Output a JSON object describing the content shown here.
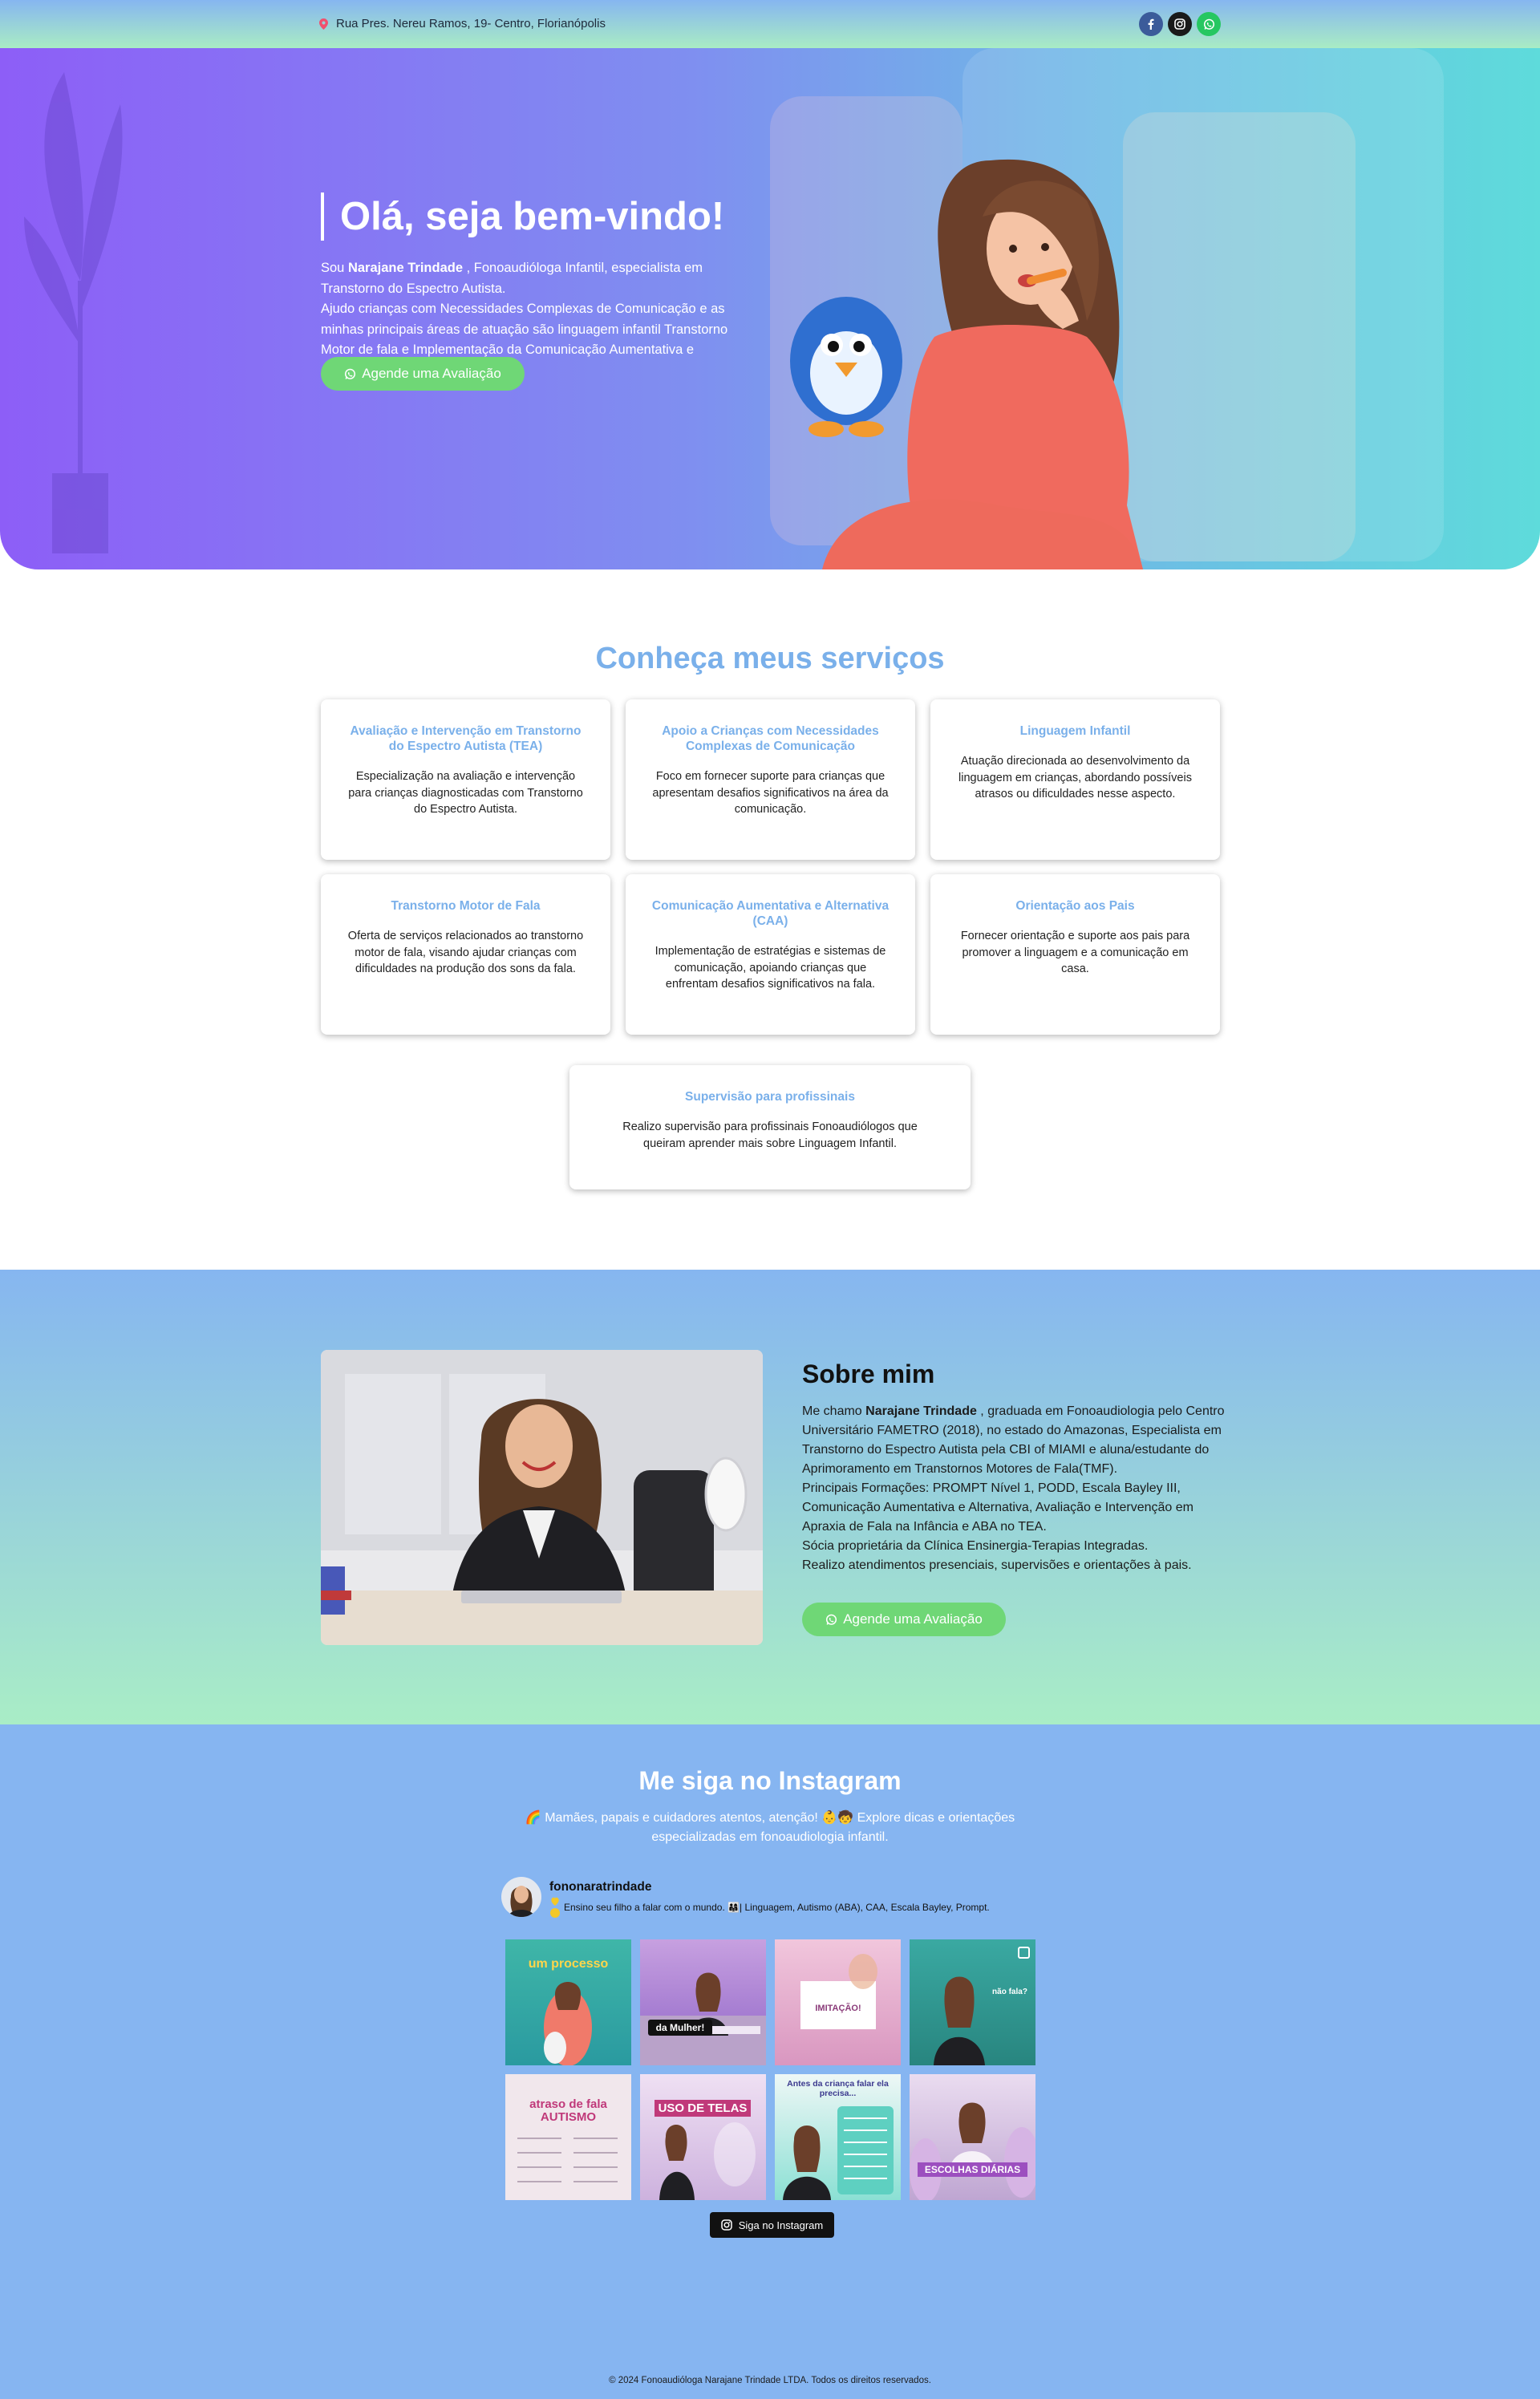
{
  "topbar": {
    "address": "Rua Pres. Nereu Ramos, 19- Centro, Florianópolis",
    "social": [
      "facebook-icon",
      "instagram-icon",
      "whatsapp-icon"
    ]
  },
  "hero": {
    "title": "Olá, seja bem-vindo!",
    "intro_prefix": "Sou ",
    "name": "Narajane Trindade",
    "intro_suffix": " , Fonoaudióloga Infantil, especialista em Transtorno do Espectro Autista.",
    "line2": "Ajudo crianças com Necessidades Complexas de Comunicação e as minhas principais áreas de atuação são linguagem infantil Transtorno Motor de fala e Implementação da Comunicação Aumentativa e Alternativa(CAA).",
    "cta": "Agende uma Avaliação"
  },
  "services": {
    "title": "Conheça meus serviços",
    "items": [
      {
        "title": "Avaliação e Intervenção em Transtorno do Espectro Autista (TEA)",
        "text": "Especialização na avaliação e intervenção para crianças diagnosticadas com Transtorno do Espectro Autista."
      },
      {
        "title": "Apoio a Crianças com Necessidades Complexas de Comunicação",
        "text": "Foco em fornecer suporte para crianças que apresentam desafios significativos na área da comunicação."
      },
      {
        "title": "Linguagem Infantil",
        "text": "Atuação direcionada ao desenvolvimento da linguagem em crianças, abordando possíveis atrasos ou dificuldades nesse aspecto."
      },
      {
        "title": "Transtorno Motor de Fala",
        "text": "Oferta de serviços relacionados ao transtorno motor de fala, visando ajudar crianças com dificuldades na produção dos sons da fala."
      },
      {
        "title": "Comunicação Aumentativa e Alternativa (CAA)",
        "text": "Implementação de estratégias e sistemas de comunicação, apoiando crianças que enfrentam desafios significativos na fala."
      },
      {
        "title": "Orientação aos Pais",
        "text": "Fornecer orientação e suporte aos pais para promover a linguagem e a comunicação em casa."
      },
      {
        "title": "Supervisão para profissinais",
        "text": "Realizo supervisão para profissinais Fonoaudiólogos que queiram aprender mais sobre Linguagem Infantil."
      }
    ]
  },
  "about": {
    "title": "Sobre mim",
    "p1_prefix": "Me chamo ",
    "name": "Narajane Trindade",
    "p1_suffix": " , graduada em Fonoaudiologia pelo Centro Universitário FAMETRO (2018), no estado do Amazonas, Especialista em Transtorno do Espectro Autista pela CBI of MIAMI e aluna/estudante do Aprimoramento em Transtornos Motores de Fala(TMF).",
    "p2": "Principais Formações: PROMPT Nível 1, PODD, Escala Bayley III, Comunicação Aumentativa e Alternativa, Avaliação e Intervenção em Apraxia de Fala na Infância e ABA no TEA.",
    "p3": "Sócia proprietária da Clínica Ensinergia-Terapias Integradas.",
    "p4": "Realizo atendimentos presenciais, supervisões e orientações à pais.",
    "cta": "Agende uma Avaliação"
  },
  "instagram": {
    "title": "Me siga no Instagram",
    "subtitle": "🌈 Mamães, papais e cuidadores atentos, atenção! 👶🧒 Explore dicas e orientações especializadas em fonoaudiologia infantil.",
    "username": "fononaratrindade",
    "bio": "Ensino seu filho a falar com o mundo. 👨‍👩‍👧| Linguagem, Autismo (ABA), CAA, Escala Bayley, Prompt.",
    "tiles": [
      {
        "caption": "um processo",
        "bg": "#3fb6a8"
      },
      {
        "caption": "da Mulher!",
        "bg": "#b98bd6"
      },
      {
        "caption": "IMITAÇÃO!",
        "bg": "#e9b8d2"
      },
      {
        "caption": "não fala?",
        "bg": "#2f9a95"
      },
      {
        "caption": "atraso de fala AUTISMO",
        "bg": "#f1e7ec"
      },
      {
        "caption": "USO DE TELAS",
        "bg": "#d9c7e6"
      },
      {
        "caption": "Antes da criança falar ela precisa...",
        "bg": "#8be0d4"
      },
      {
        "caption": "ESCOLHAS DIÁRIAS",
        "bg": "#c8b6d8"
      }
    ],
    "follow": "Siga no Instagram"
  },
  "footer": "© 2024 Fonoaudióloga Narajane Trindade LTDA. Todos os direitos reservados."
}
